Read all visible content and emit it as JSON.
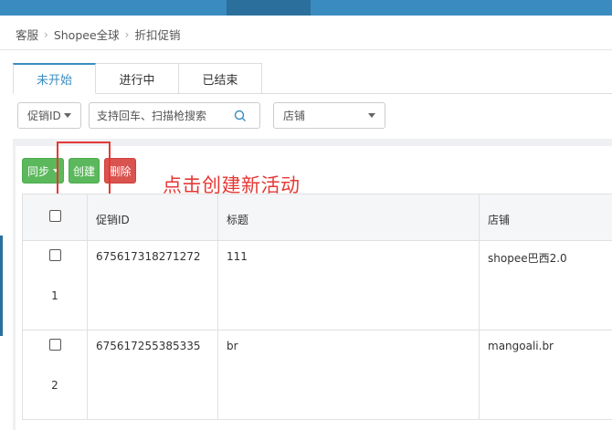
{
  "breadcrumb": {
    "items": [
      "客服",
      "Shopee全球",
      "折扣促销"
    ]
  },
  "tabs": [
    {
      "label": "未开始"
    },
    {
      "label": "进行中"
    },
    {
      "label": "已结束"
    }
  ],
  "filters": {
    "field_select": "促销ID",
    "search_placeholder": "支持回车、扫描枪搜索",
    "store_select": "店铺"
  },
  "toolbar": {
    "sync_label": "同步",
    "create_label": "创建",
    "delete_label": "删除"
  },
  "annotation": "点击创建新活动",
  "table": {
    "columns": [
      "促销ID",
      "标题",
      "店铺"
    ],
    "rows": [
      {
        "index": "1",
        "promo_id": "675617318271272",
        "title": "111",
        "store": "shopee巴西2.0"
      },
      {
        "index": "2",
        "promo_id": "675617255385335",
        "title": "br",
        "store": "mangoali.br"
      }
    ]
  },
  "colors": {
    "topbar": "#3a8cc0",
    "tab_active": "#3a8cc0",
    "success": "#5cb85c",
    "danger": "#d9534f",
    "annotation": "#e53935"
  }
}
